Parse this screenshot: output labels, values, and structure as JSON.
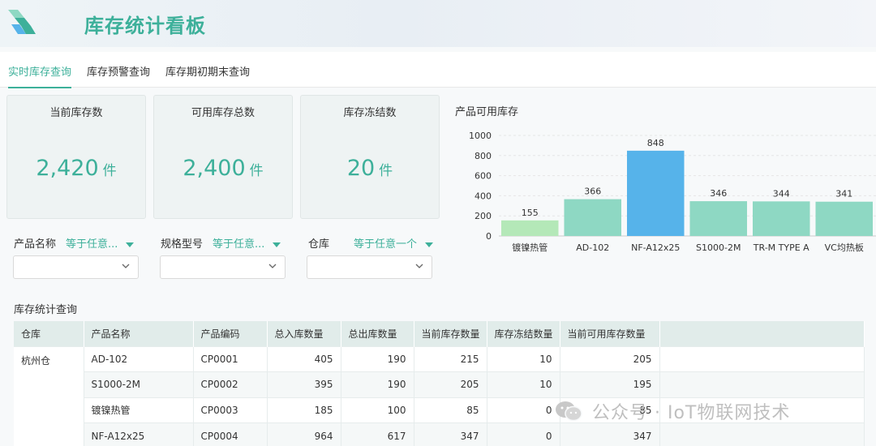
{
  "header": {
    "title": "库存统计看板"
  },
  "tabs": [
    {
      "label": "实时库存查询",
      "active": true
    },
    {
      "label": "库存预警查询",
      "active": false
    },
    {
      "label": "库存期初期末查询",
      "active": false
    }
  ],
  "stats": [
    {
      "label": "当前库存数",
      "value": "2,420",
      "unit": "件"
    },
    {
      "label": "可用库存总数",
      "value": "2,400",
      "unit": "件"
    },
    {
      "label": "库存冻结数",
      "value": "20",
      "unit": "件"
    }
  ],
  "chart_data": {
    "type": "bar",
    "title": "产品可用库存",
    "categories": [
      "镀镍热管",
      "AD-102",
      "NF-A12x25",
      "S1000-2M",
      "TR-M TYPE A",
      "VC均热板"
    ],
    "values": [
      155,
      366,
      848,
      346,
      344,
      341
    ],
    "ylim": [
      0,
      1000
    ],
    "yticks": [
      0,
      200,
      400,
      600,
      800,
      1000
    ],
    "grid": true,
    "colors": [
      "#b4e8b8",
      "#8ed8c3",
      "#56b3ea",
      "#8ed8c3",
      "#8ed8c3",
      "#8ed8c3"
    ]
  },
  "filters": [
    {
      "label": "产品名称",
      "operator": "等于任意..."
    },
    {
      "label": "规格型号",
      "operator": "等于任意..."
    },
    {
      "label": "仓库",
      "operator": "等于任意一个"
    }
  ],
  "table": {
    "title": "库存统计查询",
    "columns": [
      "仓库",
      "产品名称",
      "产品编码",
      "总入库数量",
      "总出库数量",
      "当前库存数量",
      "库存冻结数量",
      "当前可用库存数量"
    ],
    "warehouse": "杭州仓",
    "rows": [
      [
        "AD-102",
        "CP0001",
        "405",
        "190",
        "215",
        "10",
        "205"
      ],
      [
        "S1000-2M",
        "CP0002",
        "395",
        "190",
        "205",
        "10",
        "195"
      ],
      [
        "镀镍热管",
        "CP0003",
        "185",
        "100",
        "85",
        "0",
        "85"
      ],
      [
        "NF-A12x25",
        "CP0004",
        "964",
        "617",
        "347",
        "0",
        "347"
      ]
    ]
  },
  "watermark": "公众号 · IoT物联网技术",
  "colors": {
    "accent": "#3db09a",
    "header_bg": "#e1ecea"
  }
}
